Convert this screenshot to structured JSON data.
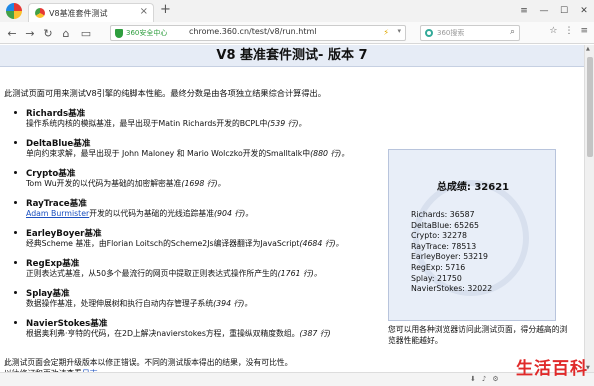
{
  "browser": {
    "tab_title": "V8基准套件测试",
    "tab_close": "×",
    "new_tab": "+",
    "window_controls": [
      "≡",
      "—",
      "☐",
      "✕"
    ],
    "nav": {
      "back": "←",
      "forward": "→",
      "reload": "↻",
      "home": "⌂",
      "sidebar_toggle": "▭"
    },
    "security_label": "360安全中心",
    "url": "chrome.360.cn/test/v8/run.html",
    "search_placeholder": "360搜索",
    "search_icon": "⌕",
    "toolbar_right": [
      "☆",
      "⋮",
      "≡"
    ]
  },
  "page": {
    "title": "V8 基准套件测试- 版本 7",
    "intro": "此测试页面可用来测试V8引擎的纯脚本性能。最终分数是由各项独立结果综合计算得出。",
    "benchmarks": [
      {
        "name": "Richards基准",
        "desc_pre": "操作系统内核的模拟基准，最早出现于Matin Richards开发的BCPL中",
        "lines": "(539 行)。"
      },
      {
        "name": "DeltaBlue基准",
        "desc_pre": "单向约束求解，最早出现于 John Maloney 和 Mario Wolczko开发的Smalltalk中",
        "lines": "(880 行)。"
      },
      {
        "name": "Crypto基准",
        "desc_pre": "Tom Wu开发的以代码为基础的加密解密基准",
        "lines": "(1698 行)。"
      },
      {
        "name": "RayTrace基准",
        "link": "Adam Burmister",
        "desc_pre": "开发的以代码为基础的光线追踪基准",
        "lines": "(904 行)。"
      },
      {
        "name": "EarleyBoyer基准",
        "desc_pre": "经典Scheme 基准，由Florian Loitsch的Scheme2Js编译器翻译为JavaScript",
        "lines": "(4684 行)。"
      },
      {
        "name": "RegExp基准",
        "desc_pre": "正则表达式基准，从50多个最流行的网页中提取正则表达式操作所产生的",
        "lines": "(1761 行)。"
      },
      {
        "name": "Splay基准",
        "desc_pre": "数据操作基准，处理伸展树和执行自动内存管理子系统",
        "lines": "(394 行)。"
      },
      {
        "name": "NavierStokes基准",
        "desc_pre": "根据奥利弗·亨特的代码，在2D上解决navierstokes方程，重操纵双精度数组。",
        "lines": "(387 行)"
      }
    ],
    "score": {
      "title": "总成绩: 32621",
      "results": [
        "Richards: 36587",
        "DeltaBlue: 65265",
        "Crypto: 32278",
        "RayTrace: 78513",
        "EarleyBoyer: 53219",
        "RegExp: 5716",
        "Splay: 21750",
        "NavierStokes: 32022"
      ]
    },
    "note": "您可以用各种浏览器访问此测试页面，得分越高的浏览器性能越好。",
    "footer1": "此测试页面会定期升级版本以修正错误。不同的测试版本得出的结果，没有可比性。",
    "footer2_pre": "以往修订和更改请查看",
    "footer2_link": "日志"
  },
  "watermark": "生活百科"
}
